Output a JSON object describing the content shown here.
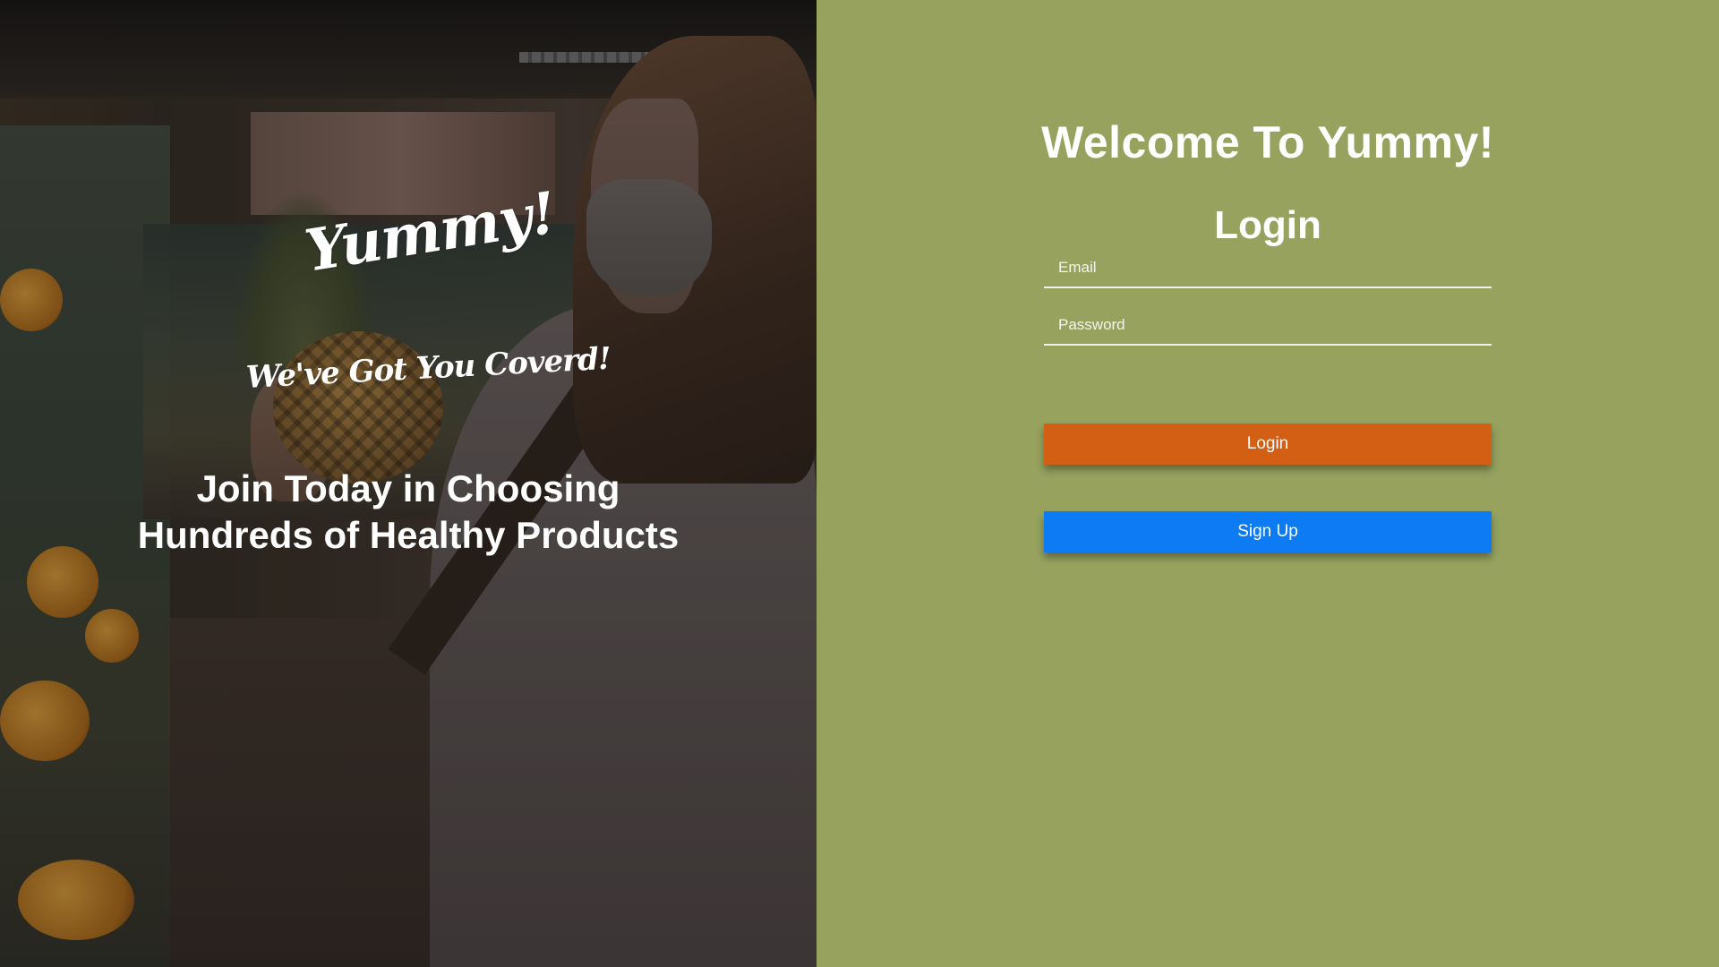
{
  "hero": {
    "logo": "Yummy!",
    "tagline": "We've Got You Coverd!",
    "headline": "Join Today in Choosing Hundreds of Healthy Products"
  },
  "form": {
    "welcome": "Welcome To Yummy!",
    "title": "Login",
    "email_placeholder": "Email",
    "password_placeholder": "Password",
    "login_label": "Login",
    "signup_label": "Sign Up"
  },
  "colors": {
    "panel_bg": "#96a25e",
    "login_button": "#d35f14",
    "signup_button": "#0c7bf4",
    "text": "#ffffff"
  }
}
